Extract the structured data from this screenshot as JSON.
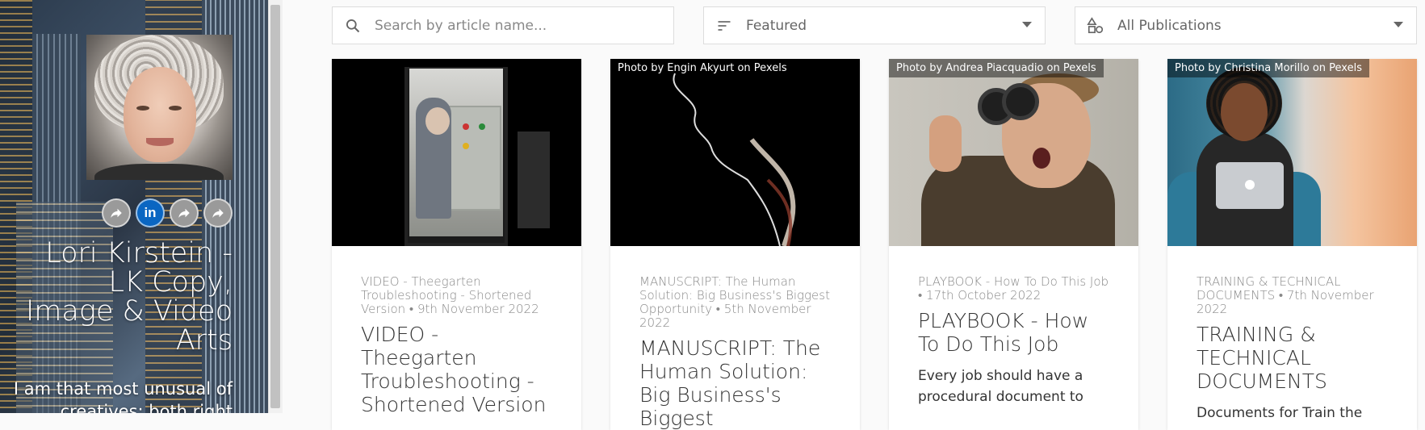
{
  "sidebar": {
    "name": "Lori Kirstein - LK Copy, Image & Video Arts",
    "bio": "I am that most unusual of creatives: both right",
    "social": [
      {
        "icon": "share-icon"
      },
      {
        "icon": "linkedin-icon",
        "label": "in"
      },
      {
        "icon": "share-icon"
      },
      {
        "icon": "share-icon"
      }
    ]
  },
  "controls": {
    "search_placeholder": "Search by article name...",
    "sort_value": "Featured",
    "publication_value": "All Publications"
  },
  "colors": {
    "linkedin": "#0a66c2",
    "meta_text": "#888888",
    "title_text": "#333333"
  },
  "cards": [
    {
      "credit": "",
      "meta": "VIDEO - Theegarten Troubleshooting - Shortened Version • 9th November 2022",
      "title": "VIDEO - Theegarten Troubleshooting - Shortened Version",
      "excerpt": ""
    },
    {
      "credit": "Photo by Engin Akyurt on Pexels",
      "meta": "MANUSCRIPT: The Human Solution: Big Business's Biggest Opportunity • 5th November 2022",
      "title": "MANUSCRIPT: The Human Solution: Big Business's Biggest",
      "excerpt": ""
    },
    {
      "credit": "Photo by Andrea Piacquadio on Pexels",
      "meta": "PLAYBOOK - How To Do This Job • 17th October 2022",
      "title": "PLAYBOOK - How To Do This Job",
      "excerpt": "Every job should have a procedural document to"
    },
    {
      "credit": "Photo by Christina Morillo on Pexels",
      "meta": "TRAINING & TECHNICAL DOCUMENTS • 7th November 2022",
      "title": "TRAINING & TECHNICAL DOCUMENTS",
      "excerpt": "Documents for Train the"
    }
  ]
}
